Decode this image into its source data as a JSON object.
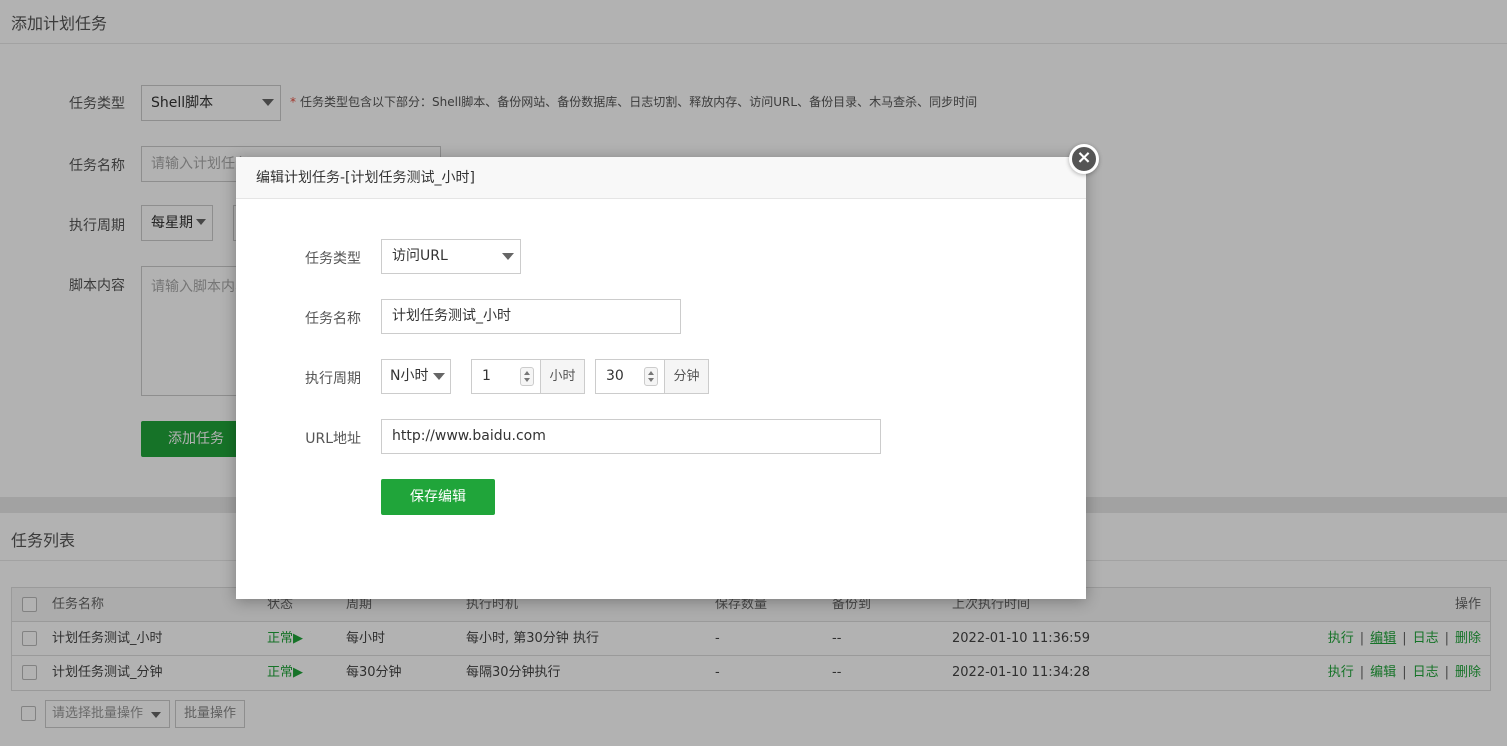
{
  "add_panel": {
    "title": "添加计划任务",
    "task_type_label": "任务类型",
    "task_type_value": "Shell脚本",
    "hint": "任务类型包含以下部分：Shell脚本、备份网站、备份数据库、日志切割、释放内存、访问URL、备份目录、木马查杀、同步时间",
    "hint_star": "*",
    "task_name_label": "任务名称",
    "task_name_placeholder": "请输入计划任务",
    "cycle_label": "执行周期",
    "cycle_value": "每星期",
    "script_label": "脚本内容",
    "script_placeholder": "请输入脚本内容",
    "add_button": "添加任务"
  },
  "list_panel": {
    "title": "任务列表",
    "columns": [
      "任务名称",
      "状态",
      "周期",
      "执行时机",
      "保存数量",
      "备份到",
      "上次执行时间",
      "操作"
    ],
    "rows": [
      {
        "name": "计划任务测试_小时",
        "status": "正常▶",
        "cycle": "每小时",
        "timing": "每小时, 第30分钟 执行",
        "keep": "-",
        "backup": "--",
        "last_run": "2022-01-10 11:36:59"
      },
      {
        "name": "计划任务测试_分钟",
        "status": "正常▶",
        "cycle": "每30分钟",
        "timing": "每隔30分钟执行",
        "keep": "-",
        "backup": "--",
        "last_run": "2022-01-10 11:34:28"
      }
    ],
    "ops": {
      "run": "执行",
      "edit": "编辑",
      "log": "日志",
      "delete": "删除",
      "sep": "|"
    },
    "batch_placeholder": "请选择批量操作",
    "batch_button": "批量操作"
  },
  "modal": {
    "title": "编辑计划任务-[计划任务测试_小时]",
    "close": "×",
    "task_type_label": "任务类型",
    "task_type_value": "访问URL",
    "task_name_label": "任务名称",
    "task_name_value": "计划任务测试_小时",
    "cycle_label": "执行周期",
    "cycle_value": "N小时",
    "hours_value": "1",
    "hours_unit": "小时",
    "minutes_value": "30",
    "minutes_unit": "分钟",
    "url_label": "URL地址",
    "url_value": "http://www.baidu.com",
    "save_button": "保存编辑"
  },
  "colors": {
    "accent": "#20a53a",
    "danger": "#e74c3c"
  }
}
